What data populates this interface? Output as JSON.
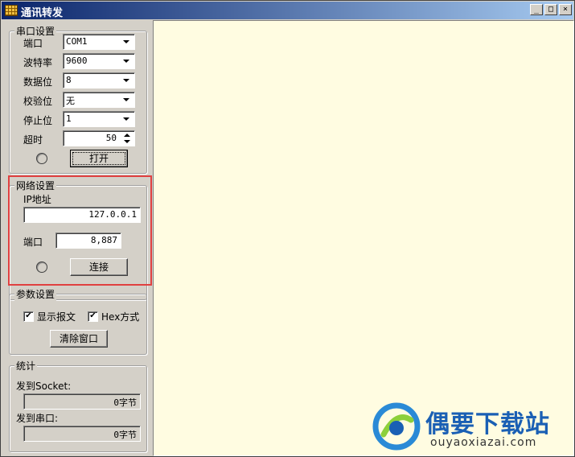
{
  "window": {
    "title": "通讯转发"
  },
  "serial": {
    "legend": "串口设置",
    "port_label": "端口",
    "port_value": "COM1",
    "baud_label": "波特率",
    "baud_value": "9600",
    "databits_label": "数据位",
    "databits_value": "8",
    "parity_label": "校验位",
    "parity_value": "无",
    "stopbits_label": "停止位",
    "stopbits_value": "1",
    "timeout_label": "超时",
    "timeout_value": "50",
    "open_button": "打开"
  },
  "network": {
    "legend": "网络设置",
    "ip_label": "IP地址",
    "ip_value": "127.0.0.1",
    "port_label": "端口",
    "port_value": "8,887",
    "connect_button": "连接"
  },
  "params": {
    "legend": "参数设置",
    "show_message_label": "显示报文",
    "show_message_checked": true,
    "hex_label": "Hex方式",
    "hex_checked": true,
    "clear_button": "清除窗口"
  },
  "stats": {
    "legend": "统计",
    "to_socket_label": "发到Socket:",
    "to_socket_value": "0字节",
    "to_serial_label": "发到串口:",
    "to_serial_value": "0字节"
  },
  "watermark": {
    "brand": "偶要下载站",
    "url": "ouyaoxiazai.com"
  },
  "colors": {
    "highlight": "#e04040",
    "log_background": "#fffce1"
  }
}
